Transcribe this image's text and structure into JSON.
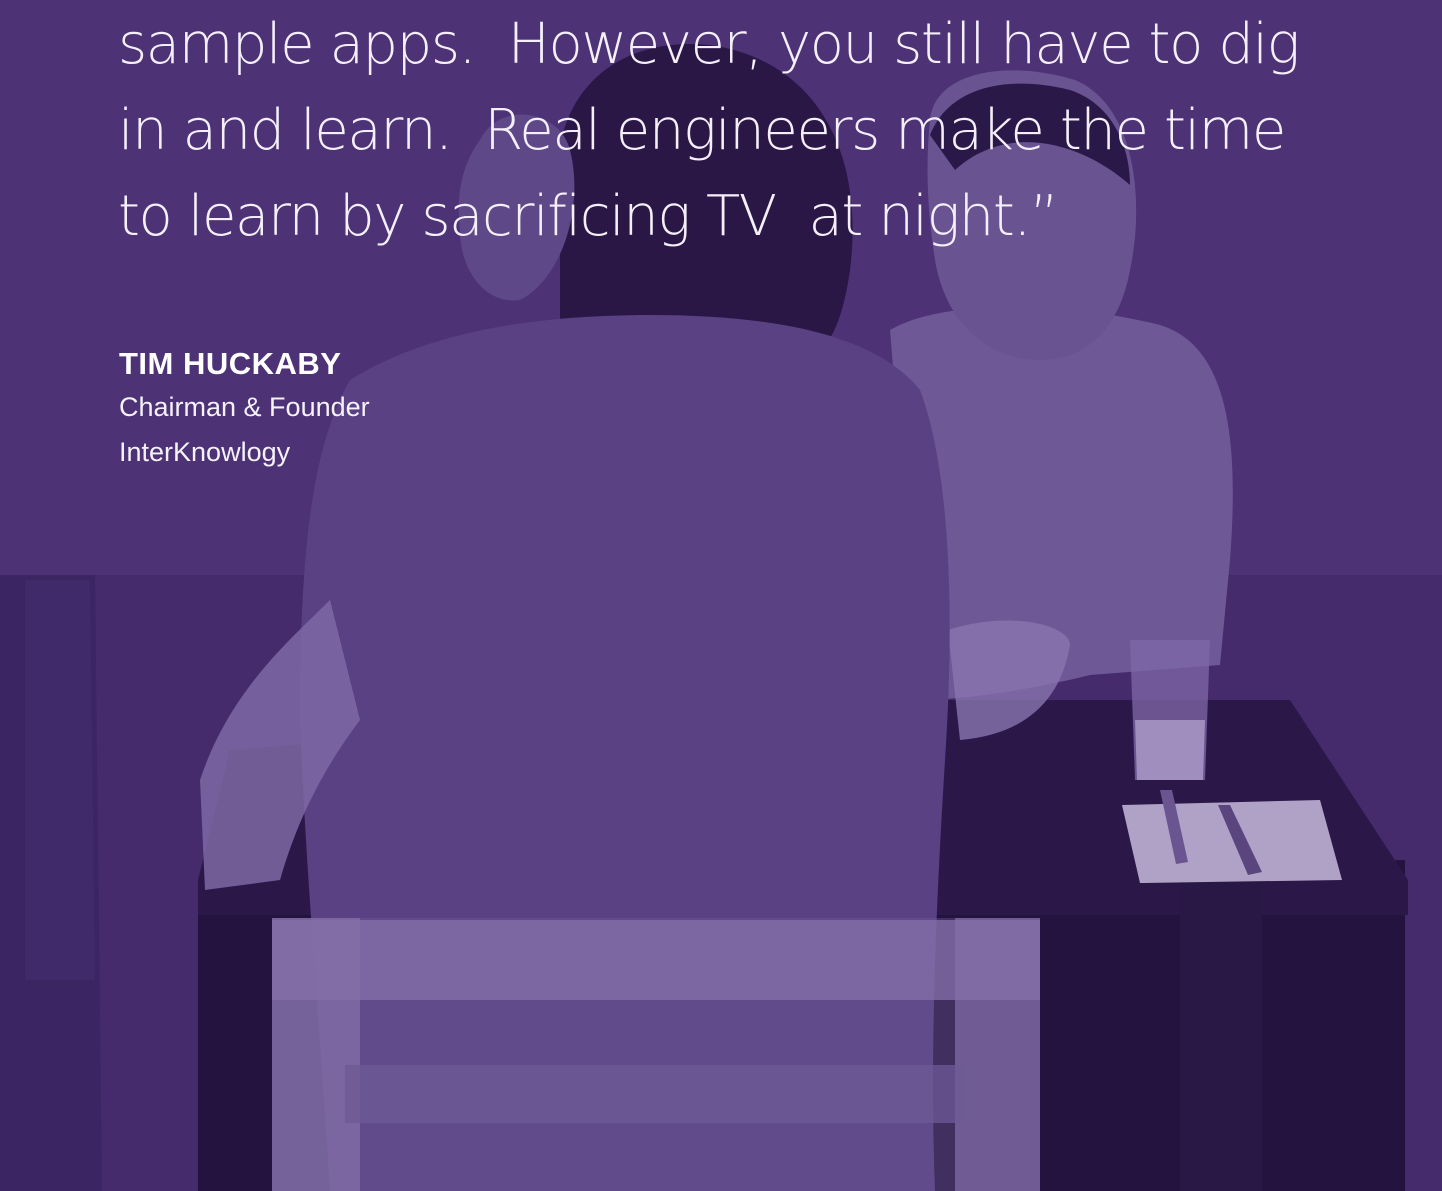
{
  "background": {
    "overlay_color": "#4b3173",
    "photo": "two-women-at-table"
  },
  "quote": {
    "lines": [
      "sample apps.  However, you still have to dig",
      "in and learn.  Real engineers make the time",
      "to learn by sacrificing TV  at night.”"
    ]
  },
  "attribution": {
    "name": "TIM HUCKABY",
    "title": "Chairman & Founder",
    "company": "InterKnowlogy"
  }
}
